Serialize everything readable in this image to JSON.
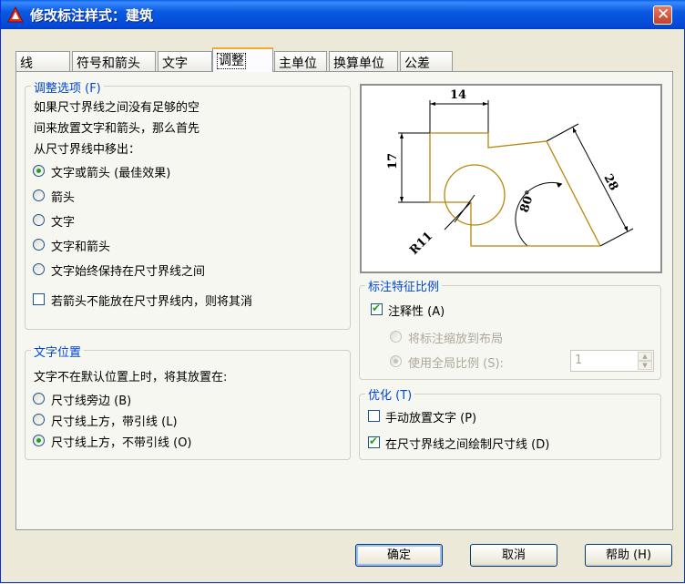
{
  "window": {
    "title": "修改标注样式：建筑"
  },
  "tabs": [
    "线",
    "符号和箭头",
    "文字",
    "调整",
    "主单位",
    "换算单位",
    "公差"
  ],
  "fit_options": {
    "legend": "调整选项 (F)",
    "description": [
      "如果尺寸界线之间没有足够的空",
      "间来放置文字和箭头，那么首先",
      "从尺寸界线中移出："
    ],
    "radios": [
      {
        "label": "文字或箭头 (最佳效果)",
        "checked": true
      },
      {
        "label": "箭头",
        "checked": false
      },
      {
        "label": "文字",
        "checked": false
      },
      {
        "label": "文字和箭头",
        "checked": false
      },
      {
        "label": "文字始终保持在尺寸界线之间",
        "checked": false
      }
    ],
    "suppress_checkbox": {
      "label": "若箭头不能放在尺寸界线内，则将其消",
      "checked": false
    }
  },
  "text_placement": {
    "legend": "文字位置",
    "description": "文字不在默认位置上时，将其放置在:",
    "radios": [
      {
        "label": "尺寸线旁边 (B)",
        "checked": false
      },
      {
        "label": "尺寸线上方，带引线 (L)",
        "checked": false
      },
      {
        "label": "尺寸线上方，不带引线 (O)",
        "checked": true
      }
    ]
  },
  "preview": {
    "dim_14": "14",
    "dim_17": "17",
    "dim_28": "28",
    "angle": "80°",
    "radius": "R11"
  },
  "scale": {
    "legend": "标注特征比例",
    "annotative": {
      "label": "注释性 (A)",
      "checked": true
    },
    "scale_to_layout": {
      "label": "将标注缩放到布局",
      "checked": false
    },
    "use_overall": {
      "label": "使用全局比例 (S):",
      "checked": true
    },
    "overall_value": "1"
  },
  "fine_tuning": {
    "legend": "优化 (T)",
    "manual_text": {
      "label": "手动放置文字 (P)",
      "checked": false
    },
    "draw_dimline": {
      "label": "在尺寸界线之间绘制尺寸线 (D)",
      "checked": true
    }
  },
  "buttons": {
    "ok": "确定",
    "cancel": "取消",
    "help": "帮助 (H)"
  },
  "colors": {
    "titlebar": "#0a5ae0",
    "legend_text": "#0046d5",
    "accent_tab": "#f7a92a",
    "preview_geometry": "#b8860b"
  }
}
